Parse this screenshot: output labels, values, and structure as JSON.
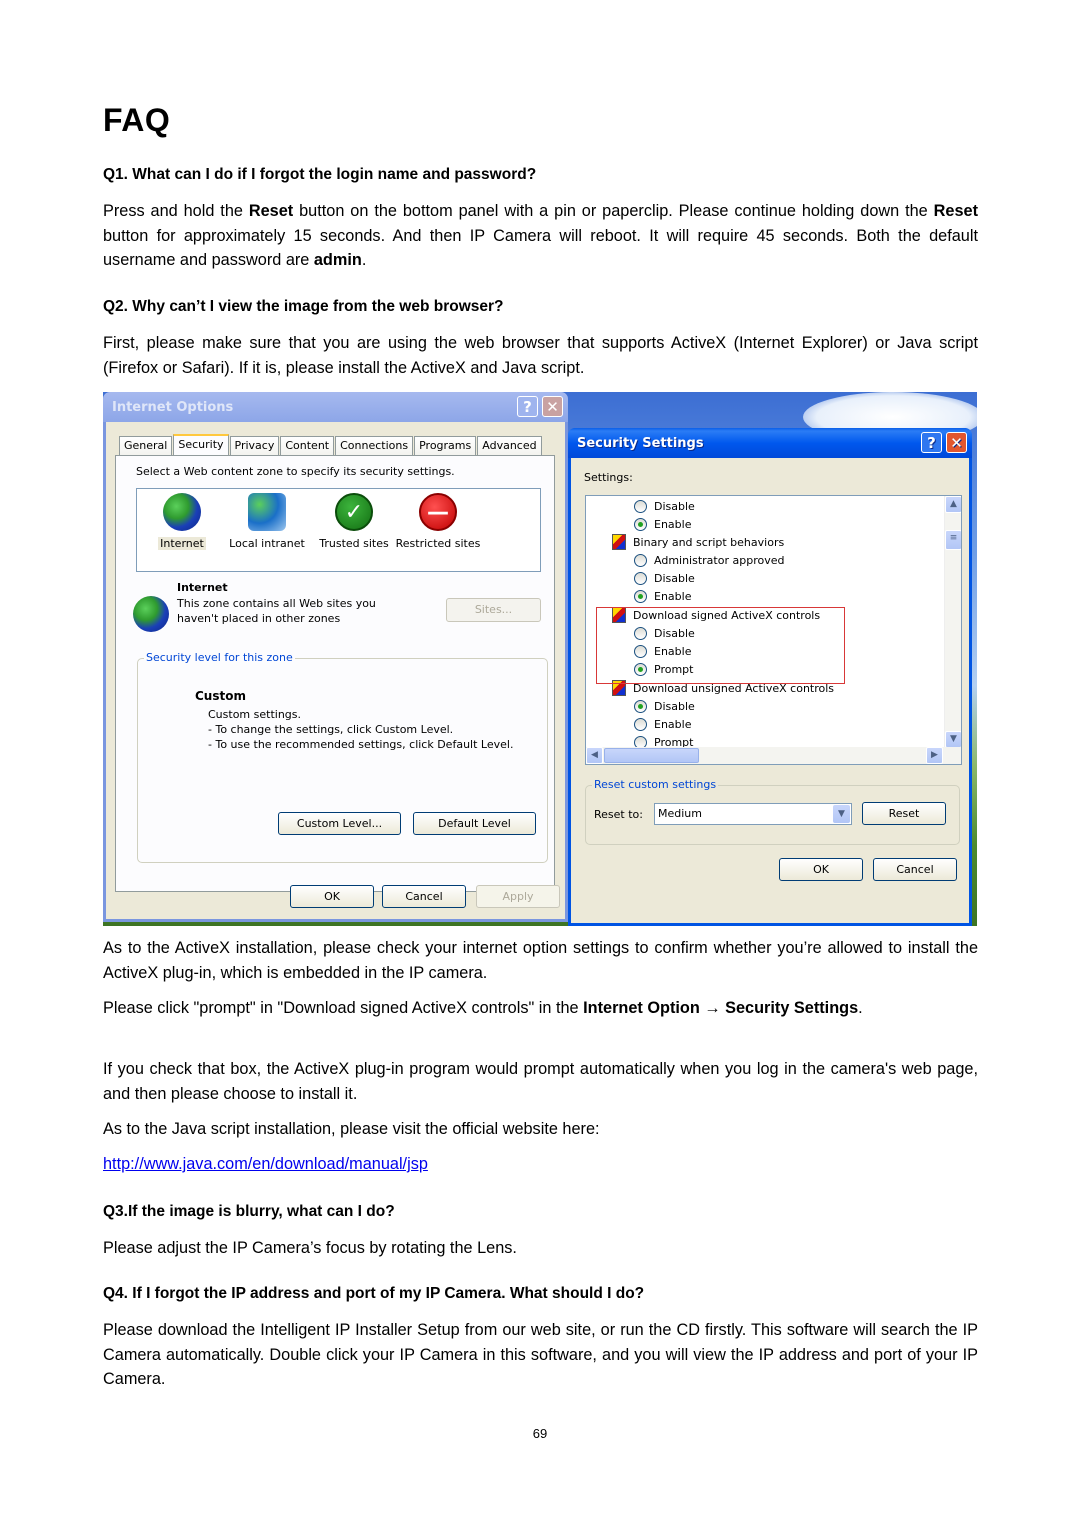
{
  "page": {
    "title": "FAQ",
    "page_number": "69"
  },
  "q1": {
    "question": "Q1. What can I do if I forgot the login name and password?",
    "answer_parts": [
      "Press and hold the ",
      "Reset",
      " button on the bottom panel with a pin or paperclip. Please continue holding down the ",
      "Reset",
      " button for approximately 15 seconds. And then IP Camera will reboot. It will require 45 seconds. Both the default username and password are ",
      "admin",
      "."
    ]
  },
  "q2": {
    "question": "Q2. Why can’t I view the image from the web browser?",
    "answer": "First, please make sure that you are using the web browser that supports ActiveX (Internet Explorer) or Java script (Firefox or Safari). If it is, please install the ActiveX and Java script.",
    "para_activex": "As to the ActiveX installation, please check your internet option settings to confirm whether you’re allowed to install the ActiveX plug-in, which is embedded in the IP camera.",
    "para_prompt_parts": [
      "Please click \"prompt\" in \"Download signed ActiveX controls\" in the ",
      "Internet Option → Security Settings",
      "."
    ],
    "para_check": "If you check that box, the ActiveX plug-in program would prompt automatically when you log in the camera's web page, and then please choose to install it.",
    "para_java": "As to the Java script installation, please visit the official website here:",
    "java_link": "http://www.java.com/en/download/manual/jsp"
  },
  "q3": {
    "question": "Q3.If the image is blurry, what can I do?",
    "answer": "Please adjust the IP Camera’s focus by rotating the Lens."
  },
  "q4": {
    "question": "Q4. If I forgot the IP address and port of my IP Camera. What should I do?",
    "answer": "Please download the Intelligent IP Installer Setup from our web site, or run the CD firstly. This software will search the IP Camera automatically. Double click your IP Camera in this software, and you will view the IP address and port of your IP Camera."
  },
  "internet_options": {
    "title": "Internet Options",
    "help_label": "?",
    "close_label": "✕",
    "tabs": [
      "General",
      "Security",
      "Privacy",
      "Content",
      "Connections",
      "Programs",
      "Advanced"
    ],
    "active_tab": "Security",
    "zone_prompt": "Select a Web content zone to specify its security settings.",
    "zones": [
      {
        "label": "Internet",
        "icon": "globe-icon",
        "selected": true
      },
      {
        "label": "Local intranet",
        "icon": "intranet-icon",
        "selected": false
      },
      {
        "label": "Trusted sites",
        "icon": "checkmark-icon",
        "selected": false
      },
      {
        "label": "Restricted sites",
        "icon": "no-entry-icon",
        "selected": false
      }
    ],
    "zone_title": "Internet",
    "zone_desc_line1": "This zone contains all Web sites you",
    "zone_desc_line2": "haven't placed in other zones",
    "sites_button": "Sites...",
    "security_level_legend": "Security level for this zone",
    "level_name": "Custom",
    "level_desc": [
      "Custom settings.",
      "- To change the settings, click Custom Level.",
      "- To use the recommended settings, click Default Level."
    ],
    "custom_level_button": "Custom Level...",
    "default_level_button": "Default Level",
    "ok_button": "OK",
    "cancel_button": "Cancel",
    "apply_button": "Apply"
  },
  "security_settings": {
    "title": "Security Settings",
    "help_label": "?",
    "close_label": "✕",
    "settings_label": "Settings:",
    "rows": [
      {
        "type": "radio",
        "label": "Disable",
        "checked": false
      },
      {
        "type": "radio",
        "label": "Enable",
        "checked": true
      },
      {
        "type": "heading",
        "label": "Binary and script behaviors"
      },
      {
        "type": "radio",
        "label": "Administrator approved",
        "checked": false
      },
      {
        "type": "radio",
        "label": "Disable",
        "checked": false
      },
      {
        "type": "radio",
        "label": "Enable",
        "checked": true
      },
      {
        "type": "heading",
        "label": "Download signed ActiveX controls"
      },
      {
        "type": "radio",
        "label": "Disable",
        "checked": false
      },
      {
        "type": "radio",
        "label": "Enable",
        "checked": false
      },
      {
        "type": "radio",
        "label": "Prompt",
        "checked": true
      },
      {
        "type": "heading",
        "label": "Download unsigned ActiveX controls"
      },
      {
        "type": "radio",
        "label": "Disable",
        "checked": true
      },
      {
        "type": "radio",
        "label": "Enable",
        "checked": false
      },
      {
        "type": "radio",
        "label": "Prompt",
        "checked": false
      }
    ],
    "reset_legend": "Reset custom settings",
    "reset_to_label": "Reset to:",
    "reset_to_value": "Medium",
    "reset_button": "Reset",
    "ok_button": "OK",
    "cancel_button": "Cancel",
    "highlight_color": "#d83838"
  }
}
